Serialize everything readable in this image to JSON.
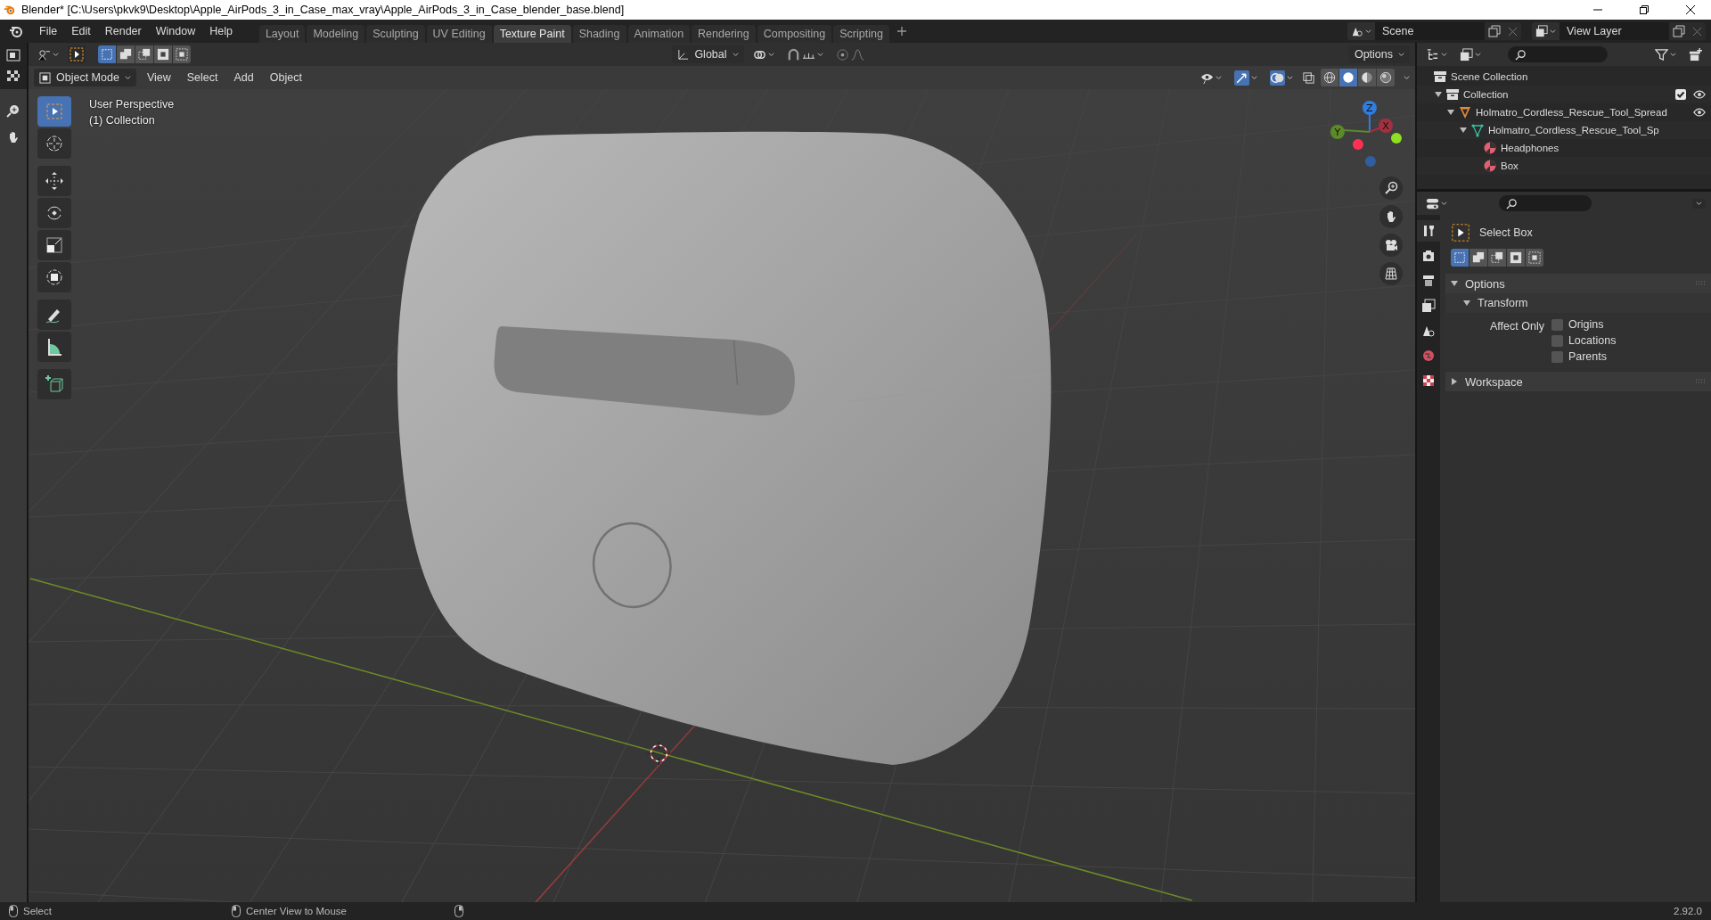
{
  "window": {
    "title": "Blender* [C:\\Users\\pkvk9\\Desktop\\Apple_AirPods_3_in_Case_max_vray\\Apple_AirPods_3_in_Case_blender_base.blend]"
  },
  "menu": [
    "File",
    "Edit",
    "Render",
    "Window",
    "Help"
  ],
  "workspace_tabs": [
    {
      "label": "Layout",
      "selected": false
    },
    {
      "label": "Modeling",
      "selected": false
    },
    {
      "label": "Sculpting",
      "selected": false
    },
    {
      "label": "UV Editing",
      "selected": false
    },
    {
      "label": "Texture Paint",
      "selected": true
    },
    {
      "label": "Shading",
      "selected": false
    },
    {
      "label": "Animation",
      "selected": false
    },
    {
      "label": "Rendering",
      "selected": false
    },
    {
      "label": "Compositing",
      "selected": false
    },
    {
      "label": "Scripting",
      "selected": false
    }
  ],
  "scene": {
    "value": "Scene"
  },
  "view_layer": {
    "value": "View Layer"
  },
  "tool_header": {
    "select_modes": [
      {
        "selected": true
      },
      {
        "selected": false
      },
      {
        "selected": false
      },
      {
        "selected": false
      },
      {
        "selected": false
      }
    ],
    "orientation": "Global",
    "options": "Options"
  },
  "viewport_header": {
    "mode": "Object Mode",
    "menus": [
      "View",
      "Select",
      "Add",
      "Object"
    ],
    "shading_modes": [
      {
        "kind": "wireframe",
        "selected": false
      },
      {
        "kind": "solid",
        "selected": true
      },
      {
        "kind": "material",
        "selected": false
      },
      {
        "kind": "rendered",
        "selected": false
      }
    ]
  },
  "viewport": {
    "perspective": "User Perspective",
    "collection": "(1) Collection",
    "gizmo_axes": [
      "Z",
      "X",
      "Y"
    ]
  },
  "toolbar": [
    {
      "kind": "select_box",
      "selected": true
    },
    {
      "kind": "cursor",
      "selected": false
    },
    {
      "kind": "move",
      "selected": false
    },
    {
      "kind": "rotate",
      "selected": false
    },
    {
      "kind": "scale",
      "selected": false
    },
    {
      "kind": "transform",
      "selected": false
    },
    {
      "kind": "annotate",
      "selected": false
    },
    {
      "kind": "measure",
      "selected": false
    },
    {
      "kind": "add_cube",
      "selected": false
    }
  ],
  "outliner": {
    "items": [
      {
        "label": "Scene Collection",
        "kind": "scene_collection",
        "children": [
          {
            "label": "Collection",
            "kind": "collection",
            "expanded": true,
            "checked": true,
            "visible": true,
            "children": [
              {
                "label": "Holmatro_Cordless_Rescue_Tool_Spread",
                "kind": "object",
                "expanded": true,
                "visible": true,
                "children": [
                  {
                    "label": "Holmatro_Cordless_Rescue_Tool_Sp",
                    "kind": "mesh",
                    "expanded": true,
                    "children": [
                      {
                        "label": "Headphones",
                        "kind": "material"
                      },
                      {
                        "label": "Box",
                        "kind": "material"
                      }
                    ]
                  }
                ]
              }
            ]
          }
        ]
      }
    ]
  },
  "properties": {
    "tabs": [
      {
        "kind": "tool",
        "selected": true
      },
      {
        "kind": "render",
        "selected": false
      },
      {
        "kind": "output",
        "selected": false
      },
      {
        "kind": "view_layer",
        "selected": false
      },
      {
        "kind": "scene",
        "selected": false
      },
      {
        "kind": "world",
        "selected": false
      },
      {
        "kind": "texture",
        "selected": false
      }
    ],
    "tool_name": "Select Box",
    "select_modes": [
      {
        "selected": true
      },
      {
        "selected": false
      },
      {
        "selected": false
      },
      {
        "selected": false
      },
      {
        "selected": false
      }
    ],
    "panels": [
      {
        "title": "Options",
        "expanded": true,
        "subpanels": [
          {
            "title": "Transform",
            "expanded": true,
            "label": "Affect Only",
            "checkboxes": [
              {
                "label": "Origins",
                "checked": false
              },
              {
                "label": "Locations",
                "checked": false
              },
              {
                "label": "Parents",
                "checked": false
              }
            ]
          }
        ]
      },
      {
        "title": "Workspace",
        "expanded": false
      }
    ]
  },
  "status_bar": {
    "items": [
      "Select",
      "Center View to Mouse"
    ],
    "version": "2.92.0"
  }
}
